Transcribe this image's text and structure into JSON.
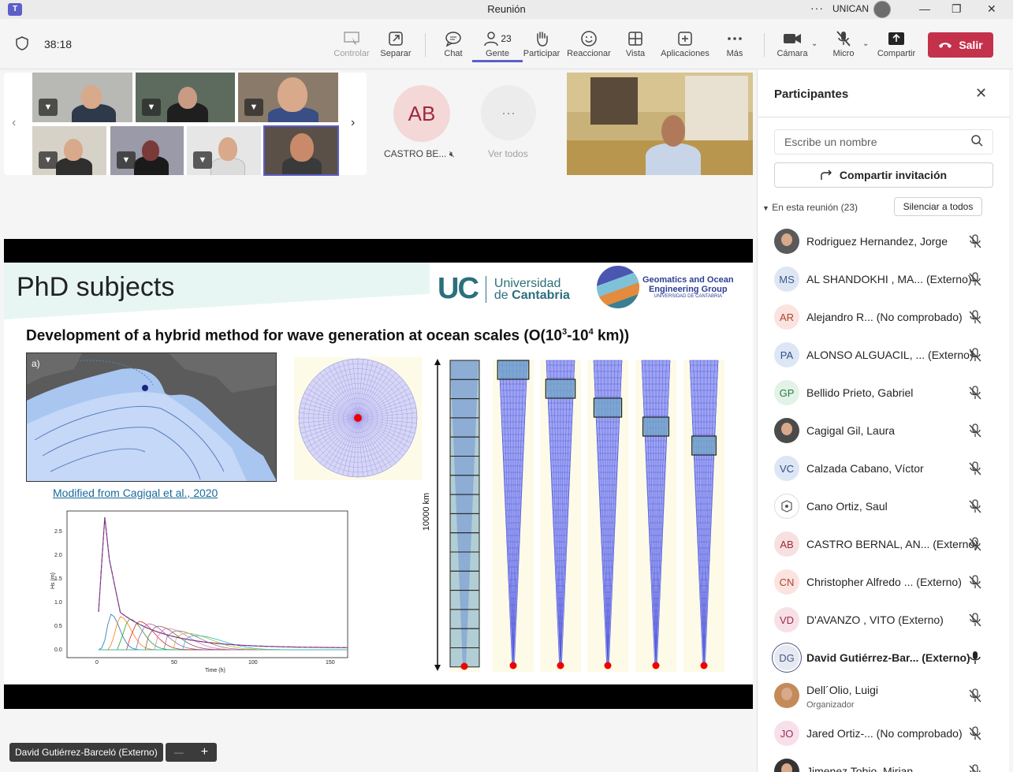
{
  "window": {
    "title": "Reunión",
    "org": "UNICAN",
    "more": "···"
  },
  "toolbar": {
    "timer": "38:18",
    "buttons": [
      {
        "id": "control",
        "label": "Controlar",
        "icon": "control-icon",
        "disabled": true
      },
      {
        "id": "separate",
        "label": "Separar",
        "icon": "popout-icon"
      },
      {
        "id": "chat",
        "label": "Chat",
        "icon": "chat-icon"
      },
      {
        "id": "people",
        "label": "Gente",
        "icon": "people-icon",
        "count": "23",
        "active": true
      },
      {
        "id": "raise",
        "label": "Participar",
        "icon": "hand-icon"
      },
      {
        "id": "react",
        "label": "Reaccionar",
        "icon": "smile-icon"
      },
      {
        "id": "view",
        "label": "Vista",
        "icon": "grid-icon"
      },
      {
        "id": "apps",
        "label": "Aplicaciones",
        "icon": "plus-icon"
      },
      {
        "id": "more",
        "label": "Más",
        "icon": "more-icon"
      },
      {
        "id": "camera",
        "label": "Cámara",
        "icon": "camera-icon"
      },
      {
        "id": "mic",
        "label": "Micro",
        "icon": "mic-off-icon"
      },
      {
        "id": "share",
        "label": "Compartir",
        "icon": "share-icon"
      }
    ],
    "leave_label": "Salir"
  },
  "strip": {
    "ab_initials": "AB",
    "ab_name": "CASTRO BE...",
    "see_all": "Ver todos"
  },
  "slide": {
    "title": "PhD subjects",
    "uc_short": "UC",
    "uc_line1": "Universidad",
    "uc_line2_pre": "de ",
    "uc_line2_bold": "Cantabria",
    "geo_line1": "Geomatics and Ocean",
    "geo_line2": "Engineering Group",
    "geo_line3": "UNIVERSIDAD DE CANTABRIA",
    "subtitle_pre": "Development of a hybrid method for wave generation at ocean scales (O(10",
    "exp1": "3",
    "dash": "-10",
    "exp2": "4",
    "subtitle_post": " km))",
    "map_label": "a)",
    "citation": "Modified from Cagigal et al., 2020",
    "scale_label": "10000 km",
    "plot": {
      "ylabel": "Hs (m)",
      "xlabel": "Time (h)",
      "yticks": [
        "2.5",
        "2.0",
        "1.5",
        "1.0",
        "0.5",
        "0.0"
      ],
      "xticks": [
        "0",
        "50",
        "100",
        "150"
      ]
    }
  },
  "presenter": {
    "name": "David Gutiérrez-Barceló (Externo)",
    "zoom_out": "—",
    "zoom_in": "+"
  },
  "panel": {
    "title": "Participantes",
    "search_placeholder": "Escribe un nombre",
    "invite_label": "Compartir invitación",
    "section_label": "En esta reunión (23)",
    "mute_all_label": "Silenciar a todos",
    "participants": [
      {
        "initials": "",
        "name": "Rodriguez Hernandez, Jorge",
        "photo": true,
        "avatar_bg": "#5a5a5a",
        "avatar_fg": "#fff",
        "mic": "off"
      },
      {
        "initials": "MS",
        "name": "AL SHANDOKHI , MA... (Externo)",
        "avatar_bg": "#dfe6f3",
        "avatar_fg": "#3b5a8a",
        "mic": "off"
      },
      {
        "initials": "AR",
        "name": "Alejandro R... (No comprobado)",
        "avatar_bg": "#fbe3df",
        "avatar_fg": "#b1432e",
        "mic": "off"
      },
      {
        "initials": "PA",
        "name": "ALONSO ALGUACIL, ... (Externo)",
        "avatar_bg": "#dde6f5",
        "avatar_fg": "#2e4f86",
        "mic": "off"
      },
      {
        "initials": "GP",
        "name": "Bellido Prieto, Gabriel",
        "avatar_bg": "#e3f2e6",
        "avatar_fg": "#2f7a42",
        "mic": "off"
      },
      {
        "initials": "",
        "name": "Cagigal Gil, Laura",
        "photo": true,
        "avatar_bg": "#4b4b4b",
        "avatar_fg": "#fff",
        "mic": "off"
      },
      {
        "initials": "VC",
        "name": "Calzada Cabano, Víctor",
        "avatar_bg": "#dde6f5",
        "avatar_fg": "#2e4f86",
        "mic": "off"
      },
      {
        "initials": "",
        "name": "Cano Ortiz, Saul",
        "logo": true,
        "avatar_bg": "#ffffff",
        "avatar_fg": "#555",
        "mic": "off"
      },
      {
        "initials": "AB",
        "name": "CASTRO BERNAL, AN... (Externo)",
        "avatar_bg": "#f7e0e0",
        "avatar_fg": "#9c2b3a",
        "mic": "off"
      },
      {
        "initials": "CN",
        "name": "Christopher Alfredo ... (Externo)",
        "avatar_bg": "#fbe3df",
        "avatar_fg": "#b1432e",
        "mic": "off"
      },
      {
        "initials": "VD",
        "name": "D'AVANZO , VITO (Externo)",
        "avatar_bg": "#f7e0e6",
        "avatar_fg": "#9c2b52",
        "mic": "off"
      },
      {
        "initials": "DG",
        "name": "David Gutiérrez-Bar... (Externo)",
        "avatar_bg": "#e6e9f2",
        "avatar_fg": "#4a5680",
        "mic": "on",
        "speaking": true
      },
      {
        "initials": "",
        "name": "Dell´Olio, Luigi",
        "role": "Organizador",
        "photo": true,
        "avatar_bg": "#c58a5a",
        "avatar_fg": "#fff",
        "mic": "off"
      },
      {
        "initials": "JO",
        "name": "Jared Ortiz-... (No comprobado)",
        "avatar_bg": "#f7e0ea",
        "avatar_fg": "#9c2b5c",
        "mic": "off"
      },
      {
        "initials": "",
        "name": "Jimenez Tobio, Mirian",
        "photo": true,
        "avatar_bg": "#333",
        "avatar_fg": "#fff",
        "mic": "off"
      }
    ]
  }
}
